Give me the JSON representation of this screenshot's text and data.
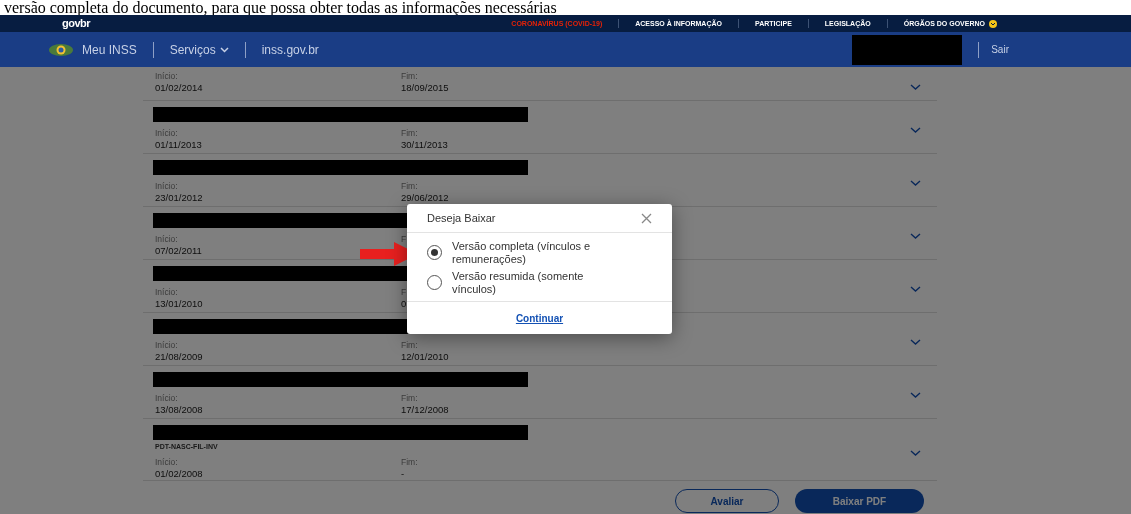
{
  "caption": "versão completa do documento, para que possa obter todas as informações necessárias",
  "topbar": {
    "logo": "govbr",
    "links": [
      {
        "label": "CORONAVÍRUS (COVID-19)",
        "kind": "alert"
      },
      {
        "label": "ACESSO À INFORMAÇÃO",
        "kind": "plain"
      },
      {
        "label": "PARTICIPE",
        "kind": "plain"
      },
      {
        "label": "LEGISLAÇÃO",
        "kind": "plain"
      },
      {
        "label": "ÓRGÃOS DO GOVERNO",
        "kind": "dropdown"
      }
    ]
  },
  "header": {
    "app": "Meu INSS",
    "menu": "Serviços",
    "site": "inss.gov.br",
    "user_redacted": true,
    "logout": "Sair"
  },
  "records": [
    {
      "redacted": false,
      "start_label": "Início:",
      "start": "01/02/2014",
      "end_label": "Fim:",
      "end": "18/09/2015"
    },
    {
      "redacted": true,
      "start_label": "Início:",
      "start": "01/11/2013",
      "end_label": "Fim:",
      "end": "30/11/2013"
    },
    {
      "redacted": true,
      "start_label": "Início:",
      "start": "23/01/2012",
      "end_label": "Fim:",
      "end": "29/06/2012"
    },
    {
      "redacted": true,
      "start_label": "Início:",
      "start": "07/02/2011",
      "end_label": "F"
    },
    {
      "redacted": true,
      "start_label": "Início:",
      "start": "13/01/2010",
      "end_label": "F",
      "end": "0"
    },
    {
      "redacted": true,
      "start_label": "Início:",
      "start": "21/08/2009",
      "end_label": "Fim:",
      "end": "12/01/2010"
    },
    {
      "redacted": true,
      "start_label": "Início:",
      "start": "13/08/2008",
      "end_label": "Fim:",
      "end": "17/12/2008"
    },
    {
      "redacted": true,
      "code": "PDT-NASC-FIL-INV",
      "start_label": "Início:",
      "start": "01/02/2008",
      "end_label": "Fim:",
      "end": "-"
    }
  ],
  "actions": [
    {
      "label": "Avaliar",
      "kind": "outline"
    },
    {
      "label": "Baixar PDF",
      "kind": "primary"
    }
  ],
  "dialog": {
    "title": "Deseja Baixar",
    "options": [
      {
        "label": "Versão completa (vínculos e remunerações)",
        "selected": true
      },
      {
        "label": "Versão resumida (somente vínculos)",
        "selected": false
      }
    ],
    "link": "Continuar"
  }
}
